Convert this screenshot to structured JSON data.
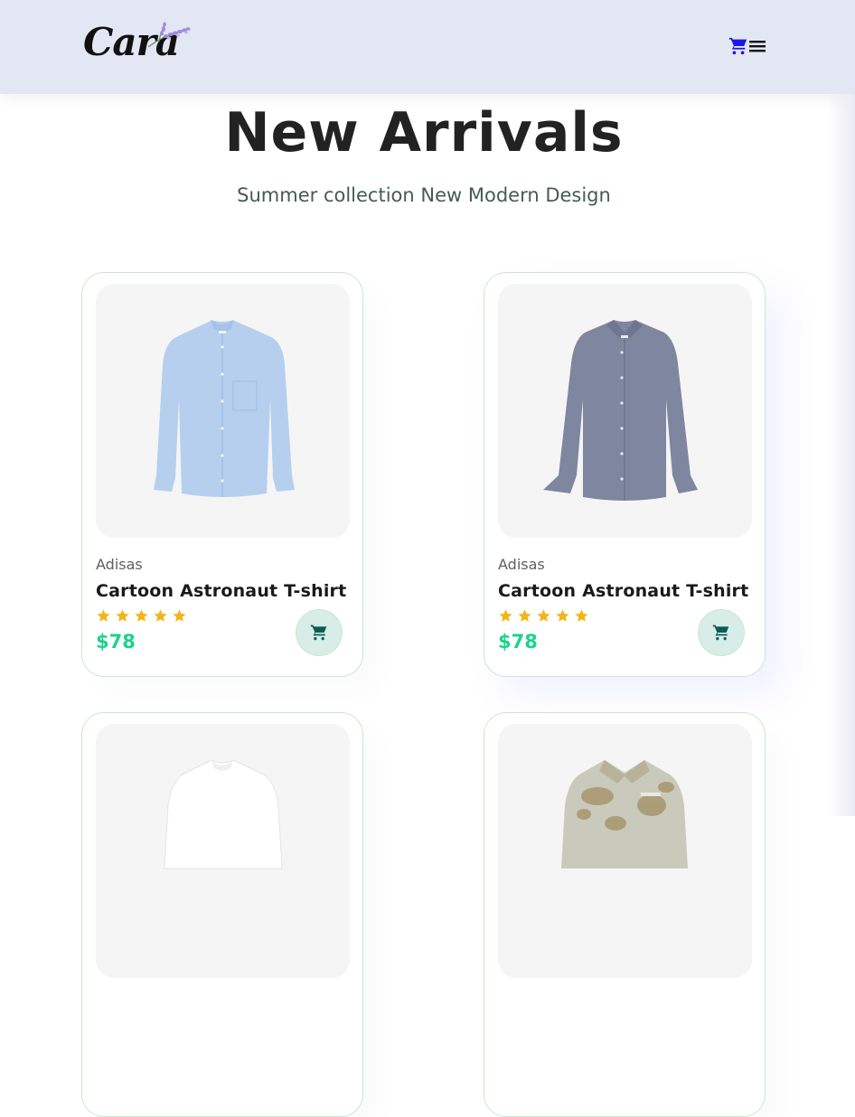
{
  "header": {
    "logo_text": "Cara",
    "icons": {
      "cart": "cart-icon",
      "menu": "menu-icon"
    },
    "cart_color": "#1a18e8"
  },
  "hero": {
    "title": "New Arrivals",
    "subtitle": "Summer collection New Modern Design"
  },
  "products": [
    {
      "brand": "Adisas",
      "name": "Cartoon Astronaut T-shirt",
      "rating": 5,
      "price": "$78",
      "image": "light-blue-shirt"
    },
    {
      "brand": "Adisas",
      "name": "Cartoon Astronaut T-shirt",
      "rating": 5,
      "price": "$78",
      "image": "grey-blue-shirt"
    },
    {
      "brand": "",
      "name": "",
      "image": "white-shirt"
    },
    {
      "brand": "",
      "name": "",
      "image": "floral-shirt"
    }
  ],
  "colors": {
    "accent": "#088178",
    "price": "#1bd48a",
    "star": "#f3b516",
    "header_bg": "#e3e6f3"
  }
}
